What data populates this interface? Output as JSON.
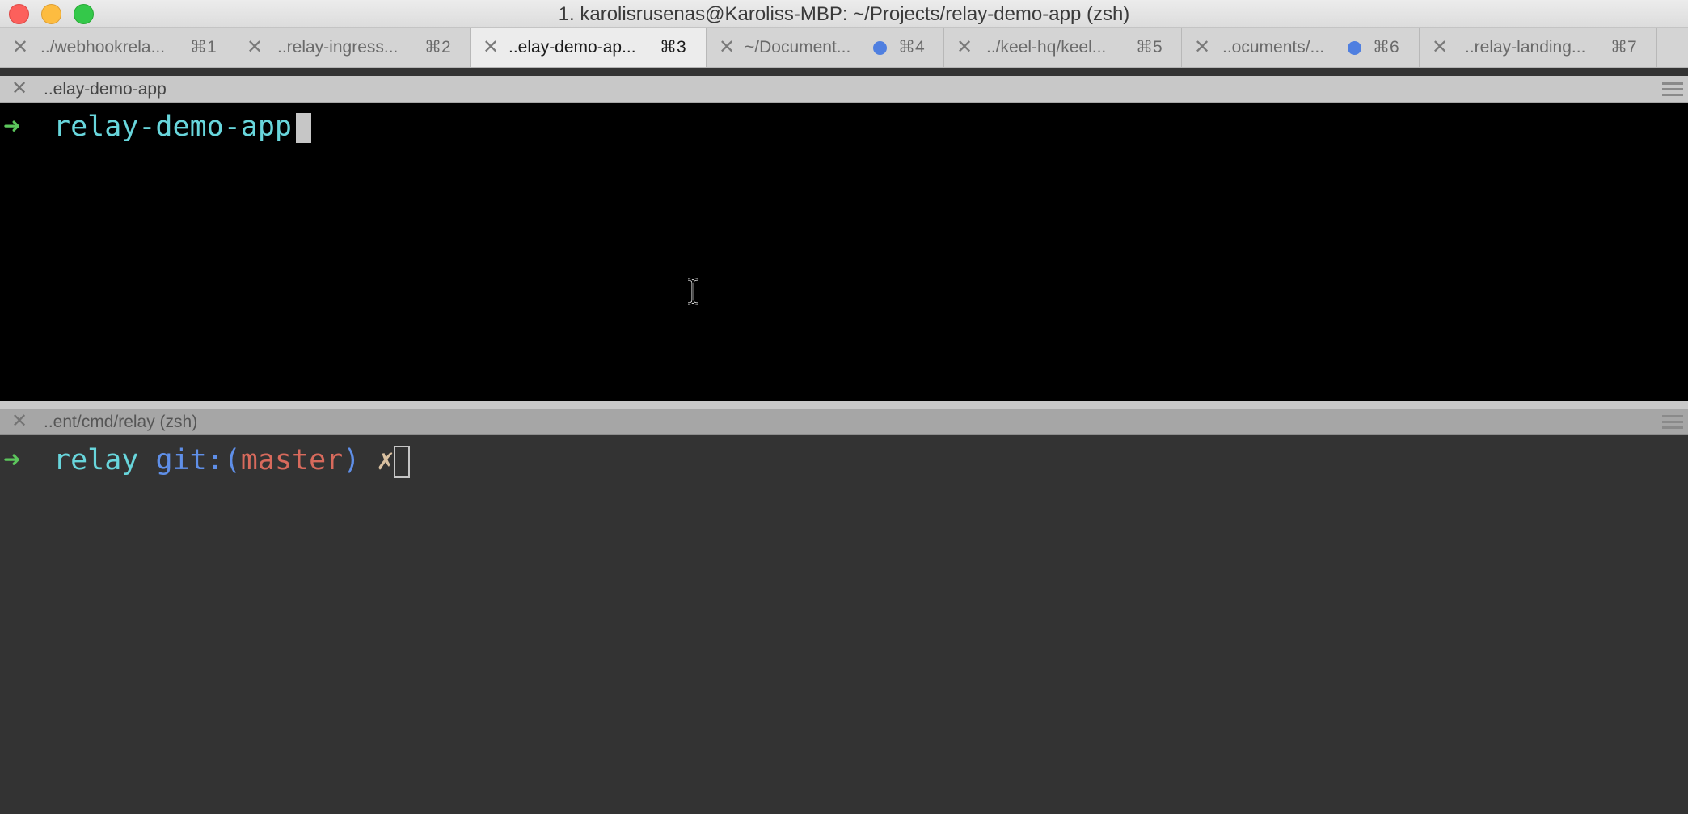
{
  "window": {
    "title": "1. karolisrusenas@Karoliss-MBP: ~/Projects/relay-demo-app (zsh)"
  },
  "tabs": [
    {
      "label": "../webhookrela...",
      "shortcut": "⌘1",
      "active": false,
      "activity": false
    },
    {
      "label": "..relay-ingress...",
      "shortcut": "⌘2",
      "active": false,
      "activity": false
    },
    {
      "label": "..elay-demo-ap...",
      "shortcut": "⌘3",
      "active": true,
      "activity": false
    },
    {
      "label": "~/Document...",
      "shortcut": "⌘4",
      "active": false,
      "activity": true
    },
    {
      "label": "../keel-hq/keel...",
      "shortcut": "⌘5",
      "active": false,
      "activity": false
    },
    {
      "label": "..ocuments/...",
      "shortcut": "⌘6",
      "active": false,
      "activity": true
    },
    {
      "label": "..relay-landing...",
      "shortcut": "⌘7",
      "active": false,
      "activity": false
    }
  ],
  "panes": {
    "top": {
      "header": "..elay-demo-app",
      "prompt_arrow": "➜",
      "prompt_dir": "relay-demo-app"
    },
    "bottom": {
      "header": "..ent/cmd/relay (zsh)",
      "prompt_arrow": "➜",
      "prompt_dir": "relay",
      "git_label_open": "git:(",
      "git_branch": "master",
      "git_label_close": ")",
      "dirty_marker": "✗"
    }
  },
  "icons": {
    "tab_close": "close-icon",
    "pane_close": "close-icon",
    "pane_menu": "hamburger-menu-icon",
    "activity": "activity-dot-icon",
    "mouse_cursor": "text-ibeam-cursor-icon"
  },
  "colors": {
    "prompt_arrow": "#5cc65c",
    "prompt_dir": "#68d6dc",
    "git_label": "#5f8fe8",
    "git_branch": "#d86a5c",
    "activity_dot": "#4f7fe0"
  }
}
